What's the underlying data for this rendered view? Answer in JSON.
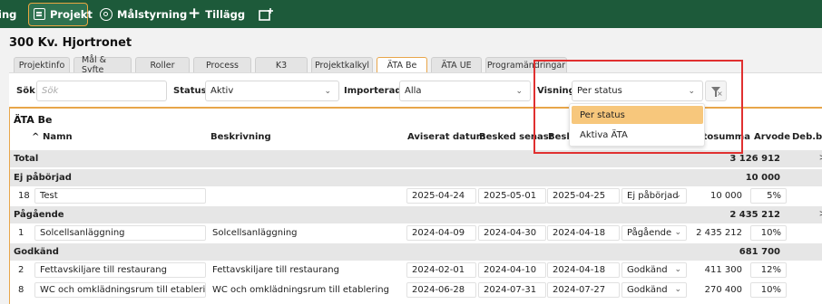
{
  "nav": {
    "items": [
      {
        "label": "ing"
      },
      {
        "label": "Projekt"
      },
      {
        "label": "Målstyrning"
      },
      {
        "label": "Tillägg"
      }
    ],
    "icons": [
      "clipboard-icon",
      "target-icon",
      "plus-icon",
      "new-window-icon"
    ]
  },
  "project": {
    "title": "300 Kv. Hjortronet"
  },
  "tabs": [
    {
      "label": "Projektinfo"
    },
    {
      "label": "Mål & Syfte"
    },
    {
      "label": "Roller"
    },
    {
      "label": "Process"
    },
    {
      "label": "K3"
    },
    {
      "label": "Projektkalkyl"
    },
    {
      "label": "ÄTA Be"
    },
    {
      "label": "ÄTA UE"
    },
    {
      "label": "Programändringar"
    }
  ],
  "filter": {
    "search_label": "Sök",
    "search_placeholder": "Sök",
    "status_label": "Status",
    "status_value": "Aktiv",
    "import_label": "Importerade",
    "import_value": "Alla",
    "view_label": "Visning",
    "view_value": "Per status"
  },
  "dropdown": {
    "options": [
      {
        "label": "Per status",
        "selected": true
      },
      {
        "label": "Aktiva ÄTA",
        "selected": false
      }
    ]
  },
  "grid": {
    "title": "ÄTA Be",
    "headers": {
      "name": "Namn",
      "description": "Beskrivning",
      "notified": "Aviserat datum",
      "latest": "Besked senast",
      "decided": "Beske",
      "total": "totosumma",
      "fee": "Arvode",
      "deb": "Deb.ba"
    },
    "sort_indicator": "^",
    "total": {
      "label": "Total",
      "value": "3 126 912"
    },
    "groups": [
      {
        "label": "Ej påbörjad",
        "value": "10 000",
        "rows": [
          {
            "nr": "18",
            "name": "Test",
            "description": "",
            "notified": "2025-04-24",
            "latest": "2025-05-01",
            "decided": "2025-04-25",
            "status": "Ej påbörjad",
            "sum": "10 000",
            "fee": "5%"
          }
        ]
      },
      {
        "label": "Pågående",
        "value": "2 435 212",
        "rows": [
          {
            "nr": "1",
            "name": "Solcellsanläggning",
            "description": "Solcellsanläggning",
            "notified": "2024-04-09",
            "latest": "2024-04-30",
            "decided": "2024-04-18",
            "status": "Pågående",
            "sum": "2 435 212",
            "fee": "10%"
          }
        ]
      },
      {
        "label": "Godkänd",
        "value": "681 700",
        "rows": [
          {
            "nr": "2",
            "name": "Fettavskiljare till restaurang",
            "description": "Fettavskiljare till restaurang",
            "notified": "2024-02-01",
            "latest": "2024-04-10",
            "decided": "2024-04-18",
            "status": "Godkänd",
            "sum": "411 300",
            "fee": "12%"
          },
          {
            "nr": "8",
            "name": "WC och omklädningsrum till etablering",
            "description": "WC och omklädningsrum till etablering",
            "notified": "2024-06-28",
            "latest": "2024-07-31",
            "decided": "2024-07-27",
            "status": "Godkänd",
            "sum": "270 400",
            "fee": "10%"
          }
        ]
      }
    ]
  },
  "colors": {
    "nav_bg": "#1d5a3a",
    "accent": "#e8a64a",
    "dropdown_selected": "#f7c77c",
    "highlight": "#e03030"
  }
}
